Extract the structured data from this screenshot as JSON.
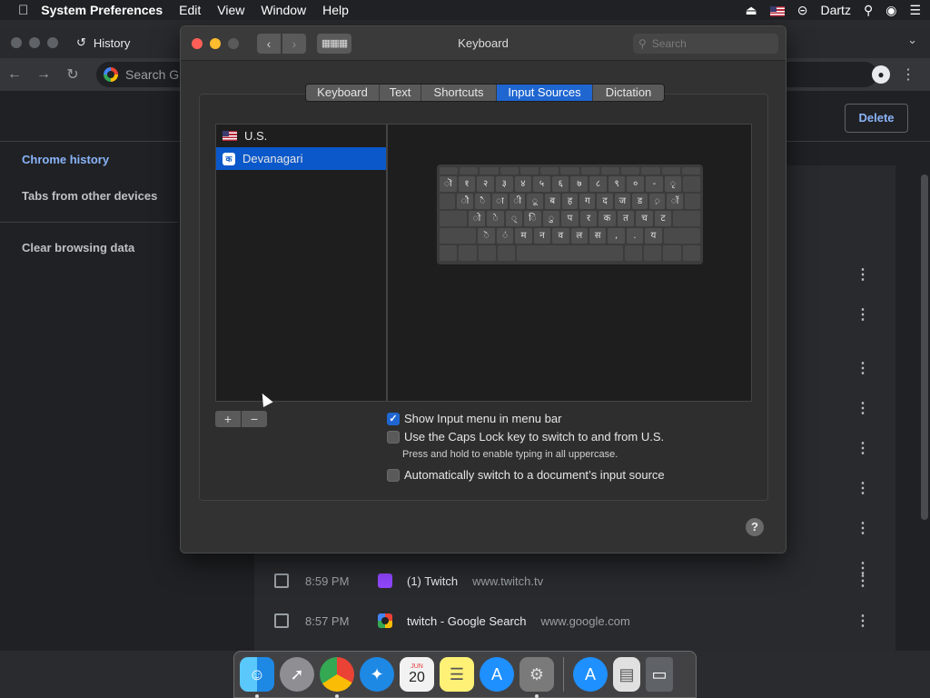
{
  "menubar": {
    "apple": "",
    "app": "System Preferences",
    "menus": [
      "Edit",
      "View",
      "Window",
      "Help"
    ],
    "user": "Dartz"
  },
  "chrome": {
    "tab_title": "History",
    "omnibox_placeholder": "Search G",
    "delete_label": "Delete",
    "sidebar": [
      "Chrome history",
      "Tabs from other devices",
      "Clear browsing data"
    ],
    "rows": [
      {
        "time": "8:59 PM",
        "title": "(1) Twitch",
        "url": "www.twitch.tv"
      },
      {
        "time": "8:57 PM",
        "title": "twitch - Google Search",
        "url": "www.google.com"
      }
    ]
  },
  "prefs": {
    "title": "Keyboard",
    "search_placeholder": "Search",
    "tabs": [
      "Keyboard",
      "Text",
      "Shortcuts",
      "Input Sources",
      "Dictation"
    ],
    "selected_tab": "Input Sources",
    "sources": [
      "U.S.",
      "Devanagari"
    ],
    "selected_source": "Devanagari",
    "devanagari_badge": "क",
    "add_label": "+",
    "remove_label": "−",
    "options": [
      {
        "label": "Show Input menu in menu bar",
        "checked": true
      },
      {
        "label": "Use the Caps Lock key to switch to and from U.S.",
        "checked": false
      },
      {
        "label": "Automatically switch to a document’s input source",
        "checked": false
      }
    ],
    "caps_hint": "Press and hold to enable typing in all uppercase.",
    "help": "?",
    "keyboard_rows": [
      [
        "ॊ",
        "१",
        "२",
        "३",
        "४",
        "५",
        "६",
        "७",
        "८",
        "९",
        "०",
        "-",
        "ृ"
      ],
      [
        "ौ",
        "ै",
        "ा",
        "ी",
        "ू",
        "ब",
        "ह",
        "ग",
        "द",
        "ज",
        "ड",
        "़",
        "ॉ"
      ],
      [
        "ो",
        "े",
        "्",
        "ि",
        "ु",
        "प",
        "र",
        "क",
        "त",
        "च",
        "ट"
      ],
      [
        "ॆ",
        "ं",
        "म",
        "न",
        "व",
        "ल",
        "स",
        ",",
        ".",
        "य"
      ]
    ]
  },
  "dock": [
    "Finder",
    "Launchpad",
    "Chrome",
    "Safari",
    "Calendar",
    "Notes",
    "App Store",
    "System Preferences",
    "App Store",
    "Preview",
    "Trash"
  ],
  "calendar": {
    "month": "JUN",
    "day": "20"
  },
  "colors": {
    "accent": "#1f66d1",
    "link": "#8ab4f8"
  }
}
